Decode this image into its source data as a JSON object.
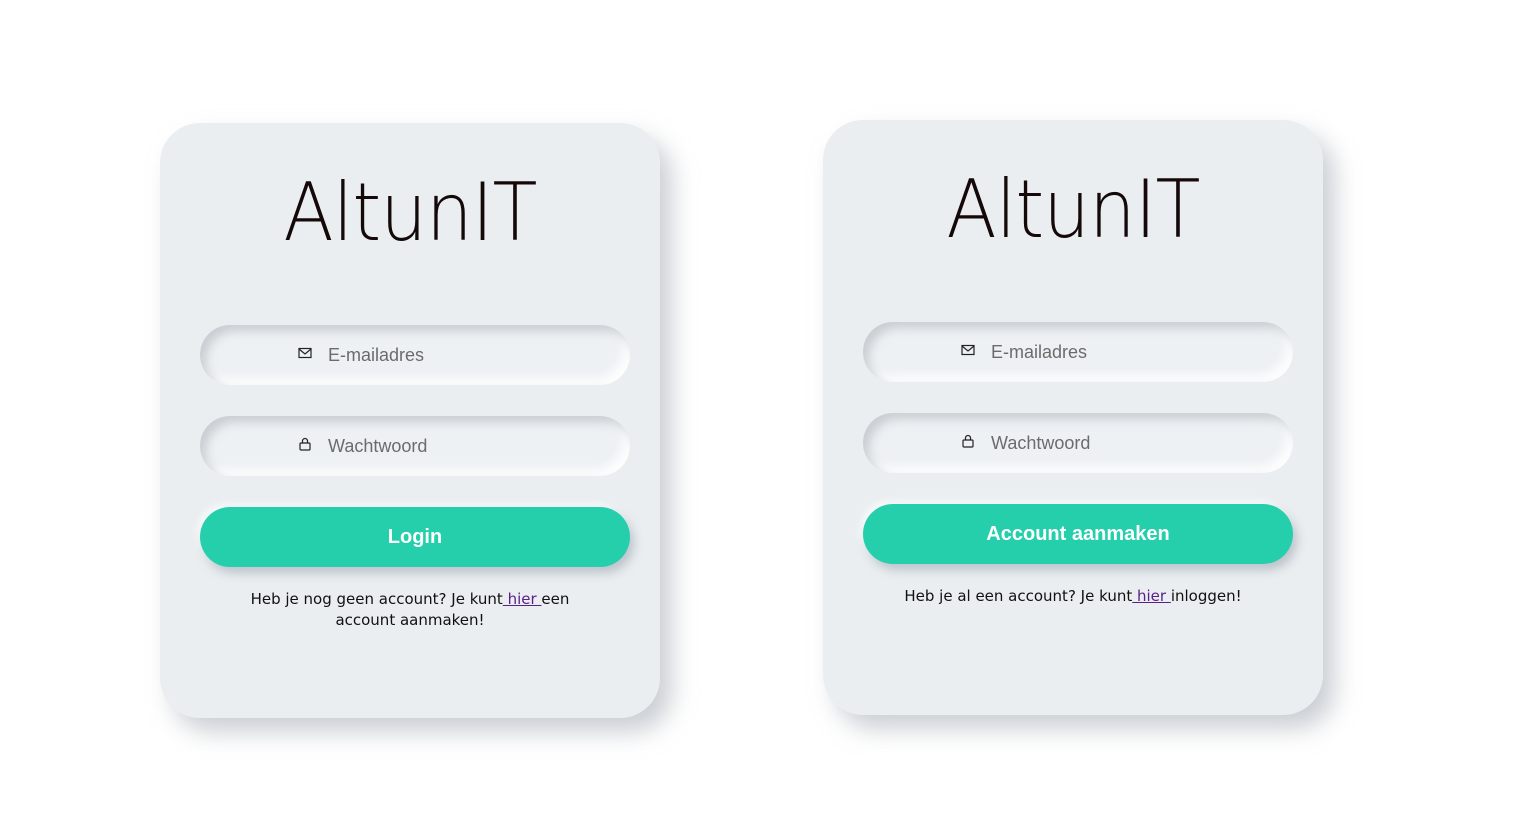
{
  "login_card": {
    "logo": "AltunIT",
    "email": {
      "placeholder": "E-mailadres",
      "icon": "mail-icon"
    },
    "password": {
      "placeholder": "Wachtwoord",
      "icon": "lock-icon"
    },
    "button_label": "Login",
    "footer": {
      "prefix": "Heb je nog geen account? Je kunt",
      "link": " hier ",
      "suffix": "een account aanmaken!"
    }
  },
  "register_card": {
    "logo": "AltunIT",
    "email": {
      "placeholder": "E-mailadres",
      "icon": "mail-icon"
    },
    "password": {
      "placeholder": "Wachtwoord",
      "icon": "lock-icon"
    },
    "button_label": "Account aanmaken",
    "footer": {
      "prefix": "Heb je al een account? Je kunt",
      "link": " hier ",
      "suffix": "inloggen!"
    }
  },
  "colors": {
    "accent": "#25cfab",
    "card_bg": "#eaeef1",
    "link": "#5a1f8a"
  }
}
